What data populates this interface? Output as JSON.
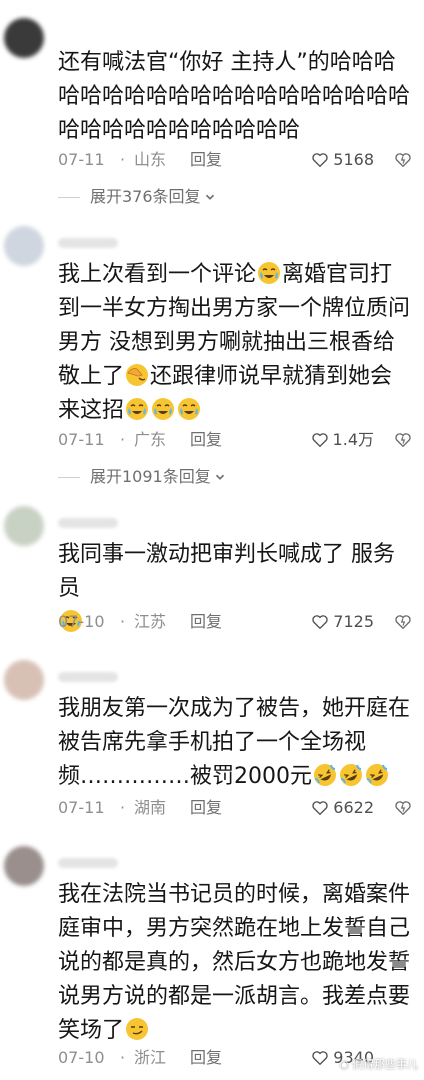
{
  "comments": [
    {
      "text": "还有喊法官“你好 主持人”的哈哈哈哈哈哈哈哈哈哈哈哈哈哈哈哈哈哈哈哈哈哈哈哈哈哈哈哈哈哈",
      "date": "07-11",
      "location": "山东",
      "reply": "回复",
      "likes": "5168",
      "expand": "展开376条回复"
    },
    {
      "text_a": "我上次看到一个评论",
      "text_b": "离婚官司打到一半女方掏出男方家一个牌位质问男方 没想到男方唰就抽出三根香给敬上了",
      "text_c": "还跟律师说早就猜到她会来这招",
      "date": "07-11",
      "location": "广东",
      "reply": "回复",
      "likes": "1.4万",
      "expand": "展开1091条回复"
    },
    {
      "text": "我同事一激动把审判长喊成了 服务员",
      "date": "07-10",
      "location": "江苏",
      "reply": "回复",
      "likes": "7125"
    },
    {
      "text": "我朋友第一次成为了被告，她开庭在被告席先拿手机拍了一个全场视频……………被罚2000元",
      "date": "07-11",
      "location": "湖南",
      "reply": "回复",
      "likes": "6622"
    },
    {
      "text": "我在法院当书记员的时候，离婚案件庭审中，男方突然跪在地上发誓自己说的都是真的，然后女方也跪地发誓说男方说的都是一派胡言。我差点要笑场了",
      "date": "07-10",
      "location": "浙江",
      "reply": "回复",
      "likes": "9340"
    }
  ],
  "separator": "·",
  "icons": [
    "heart-icon",
    "dislike-heart-icon",
    "chevron-down-icon",
    "crying-laugh-emoji",
    "tears-laugh-emoji",
    "facepalm-emoji",
    "smirk-emoji"
  ],
  "colors": {
    "text": "#161616",
    "meta": "#8e8e8e",
    "emoji": "#f7c531"
  },
  "watermark": "俱得那些事儿"
}
